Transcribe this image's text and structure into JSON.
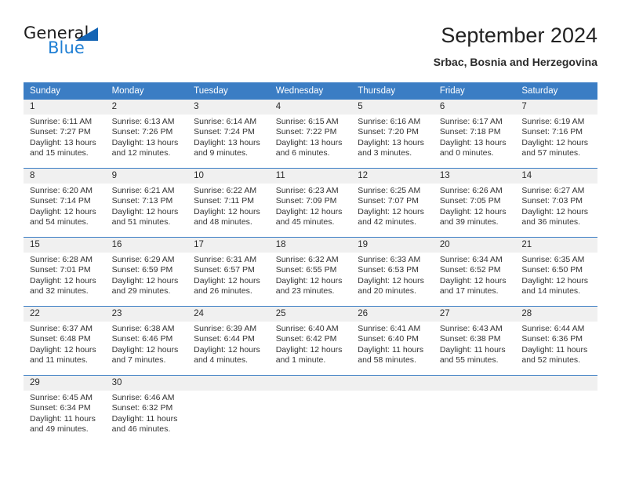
{
  "brand": {
    "name_top": "General",
    "name_bottom": "Blue",
    "accent_color": "#1f7fd4",
    "triangle_color": "#1464b4"
  },
  "header": {
    "title": "September 2024",
    "subtitle": "Srbac, Bosnia and Herzegovina"
  },
  "theme": {
    "header_bg": "#3b7dc4",
    "daynum_bg": "#f0f0f0",
    "cell_bg": "#ffffff",
    "text": "#333333"
  },
  "calendar": {
    "weekday_headers": [
      "Sunday",
      "Monday",
      "Tuesday",
      "Wednesday",
      "Thursday",
      "Friday",
      "Saturday"
    ],
    "weeks": [
      {
        "days": [
          {
            "num": "1",
            "sunrise": "Sunrise: 6:11 AM",
            "sunset": "Sunset: 7:27 PM",
            "daylight": "Daylight: 13 hours and 15 minutes."
          },
          {
            "num": "2",
            "sunrise": "Sunrise: 6:13 AM",
            "sunset": "Sunset: 7:26 PM",
            "daylight": "Daylight: 13 hours and 12 minutes."
          },
          {
            "num": "3",
            "sunrise": "Sunrise: 6:14 AM",
            "sunset": "Sunset: 7:24 PM",
            "daylight": "Daylight: 13 hours and 9 minutes."
          },
          {
            "num": "4",
            "sunrise": "Sunrise: 6:15 AM",
            "sunset": "Sunset: 7:22 PM",
            "daylight": "Daylight: 13 hours and 6 minutes."
          },
          {
            "num": "5",
            "sunrise": "Sunrise: 6:16 AM",
            "sunset": "Sunset: 7:20 PM",
            "daylight": "Daylight: 13 hours and 3 minutes."
          },
          {
            "num": "6",
            "sunrise": "Sunrise: 6:17 AM",
            "sunset": "Sunset: 7:18 PM",
            "daylight": "Daylight: 13 hours and 0 minutes."
          },
          {
            "num": "7",
            "sunrise": "Sunrise: 6:19 AM",
            "sunset": "Sunset: 7:16 PM",
            "daylight": "Daylight: 12 hours and 57 minutes."
          }
        ]
      },
      {
        "days": [
          {
            "num": "8",
            "sunrise": "Sunrise: 6:20 AM",
            "sunset": "Sunset: 7:14 PM",
            "daylight": "Daylight: 12 hours and 54 minutes."
          },
          {
            "num": "9",
            "sunrise": "Sunrise: 6:21 AM",
            "sunset": "Sunset: 7:13 PM",
            "daylight": "Daylight: 12 hours and 51 minutes."
          },
          {
            "num": "10",
            "sunrise": "Sunrise: 6:22 AM",
            "sunset": "Sunset: 7:11 PM",
            "daylight": "Daylight: 12 hours and 48 minutes."
          },
          {
            "num": "11",
            "sunrise": "Sunrise: 6:23 AM",
            "sunset": "Sunset: 7:09 PM",
            "daylight": "Daylight: 12 hours and 45 minutes."
          },
          {
            "num": "12",
            "sunrise": "Sunrise: 6:25 AM",
            "sunset": "Sunset: 7:07 PM",
            "daylight": "Daylight: 12 hours and 42 minutes."
          },
          {
            "num": "13",
            "sunrise": "Sunrise: 6:26 AM",
            "sunset": "Sunset: 7:05 PM",
            "daylight": "Daylight: 12 hours and 39 minutes."
          },
          {
            "num": "14",
            "sunrise": "Sunrise: 6:27 AM",
            "sunset": "Sunset: 7:03 PM",
            "daylight": "Daylight: 12 hours and 36 minutes."
          }
        ]
      },
      {
        "days": [
          {
            "num": "15",
            "sunrise": "Sunrise: 6:28 AM",
            "sunset": "Sunset: 7:01 PM",
            "daylight": "Daylight: 12 hours and 32 minutes."
          },
          {
            "num": "16",
            "sunrise": "Sunrise: 6:29 AM",
            "sunset": "Sunset: 6:59 PM",
            "daylight": "Daylight: 12 hours and 29 minutes."
          },
          {
            "num": "17",
            "sunrise": "Sunrise: 6:31 AM",
            "sunset": "Sunset: 6:57 PM",
            "daylight": "Daylight: 12 hours and 26 minutes."
          },
          {
            "num": "18",
            "sunrise": "Sunrise: 6:32 AM",
            "sunset": "Sunset: 6:55 PM",
            "daylight": "Daylight: 12 hours and 23 minutes."
          },
          {
            "num": "19",
            "sunrise": "Sunrise: 6:33 AM",
            "sunset": "Sunset: 6:53 PM",
            "daylight": "Daylight: 12 hours and 20 minutes."
          },
          {
            "num": "20",
            "sunrise": "Sunrise: 6:34 AM",
            "sunset": "Sunset: 6:52 PM",
            "daylight": "Daylight: 12 hours and 17 minutes."
          },
          {
            "num": "21",
            "sunrise": "Sunrise: 6:35 AM",
            "sunset": "Sunset: 6:50 PM",
            "daylight": "Daylight: 12 hours and 14 minutes."
          }
        ]
      },
      {
        "days": [
          {
            "num": "22",
            "sunrise": "Sunrise: 6:37 AM",
            "sunset": "Sunset: 6:48 PM",
            "daylight": "Daylight: 12 hours and 11 minutes."
          },
          {
            "num": "23",
            "sunrise": "Sunrise: 6:38 AM",
            "sunset": "Sunset: 6:46 PM",
            "daylight": "Daylight: 12 hours and 7 minutes."
          },
          {
            "num": "24",
            "sunrise": "Sunrise: 6:39 AM",
            "sunset": "Sunset: 6:44 PM",
            "daylight": "Daylight: 12 hours and 4 minutes."
          },
          {
            "num": "25",
            "sunrise": "Sunrise: 6:40 AM",
            "sunset": "Sunset: 6:42 PM",
            "daylight": "Daylight: 12 hours and 1 minute."
          },
          {
            "num": "26",
            "sunrise": "Sunrise: 6:41 AM",
            "sunset": "Sunset: 6:40 PM",
            "daylight": "Daylight: 11 hours and 58 minutes."
          },
          {
            "num": "27",
            "sunrise": "Sunrise: 6:43 AM",
            "sunset": "Sunset: 6:38 PM",
            "daylight": "Daylight: 11 hours and 55 minutes."
          },
          {
            "num": "28",
            "sunrise": "Sunrise: 6:44 AM",
            "sunset": "Sunset: 6:36 PM",
            "daylight": "Daylight: 11 hours and 52 minutes."
          }
        ]
      },
      {
        "days": [
          {
            "num": "29",
            "sunrise": "Sunrise: 6:45 AM",
            "sunset": "Sunset: 6:34 PM",
            "daylight": "Daylight: 11 hours and 49 minutes."
          },
          {
            "num": "30",
            "sunrise": "Sunrise: 6:46 AM",
            "sunset": "Sunset: 6:32 PM",
            "daylight": "Daylight: 11 hours and 46 minutes."
          },
          {
            "num": "",
            "sunrise": "",
            "sunset": "",
            "daylight": ""
          },
          {
            "num": "",
            "sunrise": "",
            "sunset": "",
            "daylight": ""
          },
          {
            "num": "",
            "sunrise": "",
            "sunset": "",
            "daylight": ""
          },
          {
            "num": "",
            "sunrise": "",
            "sunset": "",
            "daylight": ""
          },
          {
            "num": "",
            "sunrise": "",
            "sunset": "",
            "daylight": ""
          }
        ]
      }
    ]
  }
}
